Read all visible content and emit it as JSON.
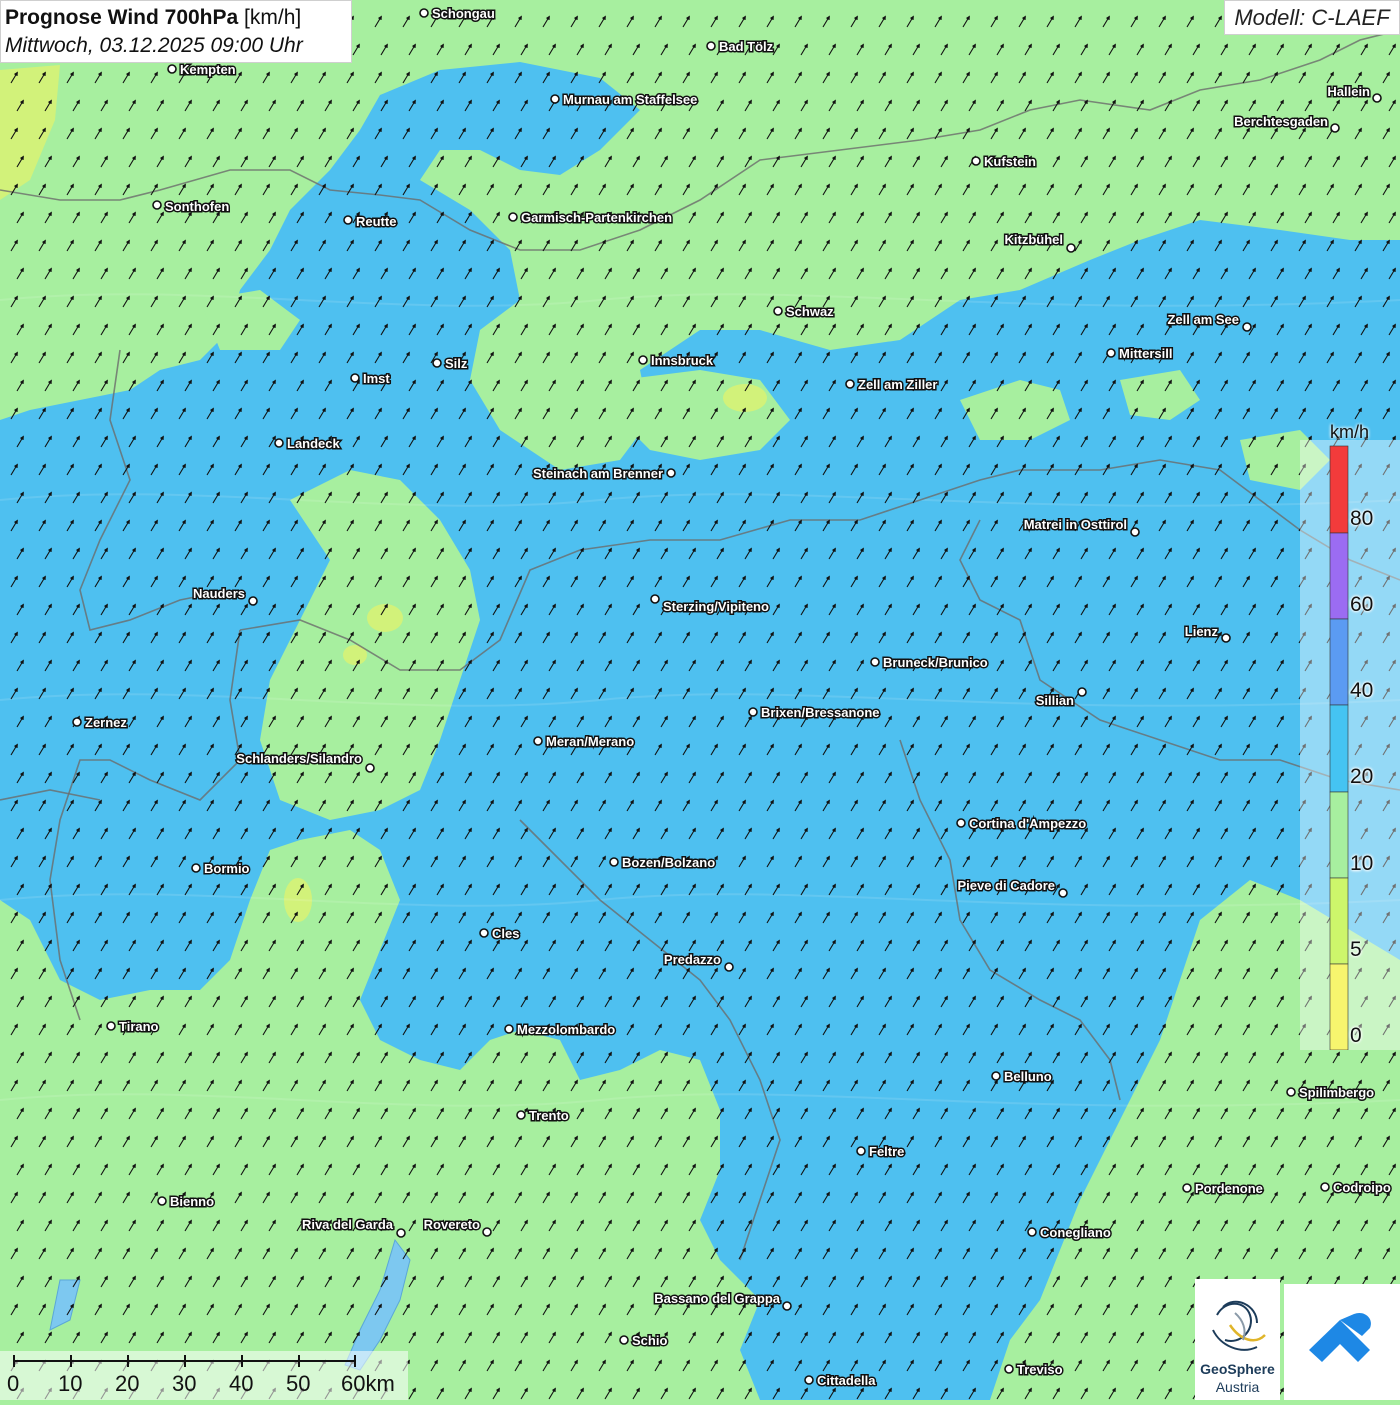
{
  "header": {
    "title_bold": "Prognose Wind 700hPa",
    "title_unit": "[km/h]",
    "datetime": "Mittwoch, 03.12.2025 09:00 Uhr"
  },
  "model": {
    "label": "Modell: C-LAEF"
  },
  "legend": {
    "unit": "km/h",
    "ticks": [
      "0",
      "5",
      "10",
      "20",
      "40",
      "60",
      "80"
    ],
    "colors": [
      "#f7f56e",
      "#cdf66b",
      "#a7ef9f",
      "#45c4f2",
      "#5b9bf2",
      "#9b6cf2",
      "#f23b3b"
    ]
  },
  "map_colors": {
    "calm_green": "#a7ef9f",
    "wind_blue": "#4ec0f0",
    "yellow_green": "#d2f27a",
    "border": "#6b6b6b"
  },
  "cities": [
    {
      "name": "Schongau"
    },
    {
      "name": "Bad Tölz"
    },
    {
      "name": "Kempten"
    },
    {
      "name": "Murnau am Staffelsee"
    },
    {
      "name": "Hallein"
    },
    {
      "name": "Berchtesgaden"
    },
    {
      "name": "Kufstein"
    },
    {
      "name": "Sonthofen"
    },
    {
      "name": "Reutte"
    },
    {
      "name": "Garmisch-Partenkirchen"
    },
    {
      "name": "Kitzbühel"
    },
    {
      "name": "Schwaz"
    },
    {
      "name": "Zell am See"
    },
    {
      "name": "Innsbruck"
    },
    {
      "name": "Mittersill"
    },
    {
      "name": "Silz"
    },
    {
      "name": "Imst"
    },
    {
      "name": "Zell am Ziller"
    },
    {
      "name": "Landeck"
    },
    {
      "name": "Steinach am Brenner"
    },
    {
      "name": "Matrei in Osttirol"
    },
    {
      "name": "Nauders"
    },
    {
      "name": "Sterzing/Vipiteno"
    },
    {
      "name": "Lienz"
    },
    {
      "name": "Bruneck/Brunico"
    },
    {
      "name": "Sillian"
    },
    {
      "name": "Brixen/Bressanone"
    },
    {
      "name": "Zernez"
    },
    {
      "name": "Meran/Merano"
    },
    {
      "name": "Schlanders/Silandro"
    },
    {
      "name": "Cortina d'Ampezzo"
    },
    {
      "name": "Bozen/Bolzano"
    },
    {
      "name": "Bormio"
    },
    {
      "name": "Pieve di Cadore"
    },
    {
      "name": "Cles"
    },
    {
      "name": "Predazzo"
    },
    {
      "name": "Tirano"
    },
    {
      "name": "Mezzolombardo"
    },
    {
      "name": "Belluno"
    },
    {
      "name": "Spilimbergo"
    },
    {
      "name": "Trento"
    },
    {
      "name": "Feltre"
    },
    {
      "name": "Pordenone"
    },
    {
      "name": "Codroipo"
    },
    {
      "name": "Bienno"
    },
    {
      "name": "Riva del Garda"
    },
    {
      "name": "Rovereto"
    },
    {
      "name": "Conegliano"
    },
    {
      "name": "Bassano del Grappa"
    },
    {
      "name": "Schio"
    },
    {
      "name": "Treviso"
    },
    {
      "name": "Cittadella"
    }
  ],
  "scalebar": {
    "labels": [
      "0",
      "10",
      "20",
      "30",
      "40",
      "50",
      "60km"
    ]
  },
  "logos": {
    "geosphere_name": "GeoSphere",
    "geosphere_sub": "Austria"
  }
}
